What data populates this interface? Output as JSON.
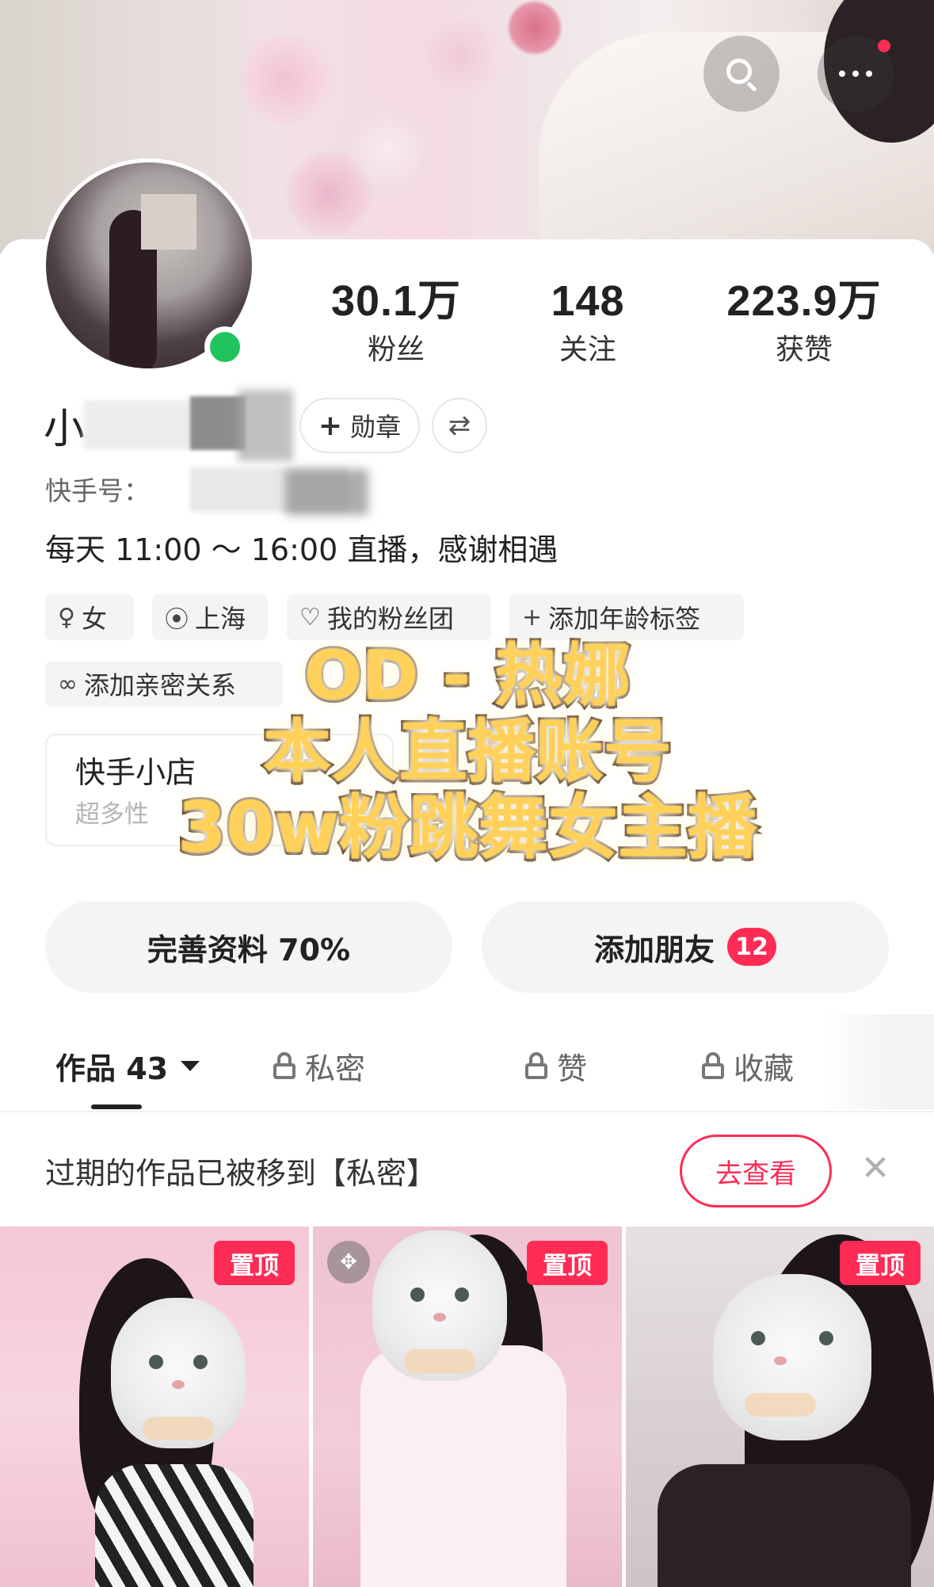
{
  "header": {
    "search_icon": "search-icon",
    "more_icon": "more-icon",
    "notification_dot_color": "#fe2c55"
  },
  "profile": {
    "nickname": "小",
    "online": true,
    "medal_label": "勋章",
    "kuaishou_id_label": "快手号：",
    "bio": "每天 11:00 ～ 16:00 直播，感谢相遇",
    "stats": [
      {
        "value": "30.1万",
        "label": "粉丝"
      },
      {
        "value": "148",
        "label": "关注"
      },
      {
        "value": "223.9万",
        "label": "获赞"
      }
    ],
    "tags": {
      "gender": "女",
      "city": "上海",
      "fan_club": "我的粉丝团",
      "add_age": "添加年龄标签",
      "add_intimate": "添加亲密关系"
    }
  },
  "shop": {
    "title": "快手小店",
    "subtitle": "超多性"
  },
  "overlay": {
    "line1": "OD - 热娜",
    "line2": "本人直播账号",
    "line3": "30w粉跳舞女主播"
  },
  "actions": {
    "complete_profile": "完善资料 70%",
    "add_friends": "添加朋友",
    "friends_badge": "12"
  },
  "tabs": {
    "works": "作品 43",
    "private": "私密",
    "likes": "赞",
    "favorites": "收藏"
  },
  "notice": {
    "text": "过期的作品已被移到【私密】",
    "button": "去查看"
  },
  "grid": {
    "pin_label": "置顶"
  },
  "colors": {
    "accent": "#fe2c55",
    "online": "#21c35e",
    "overlay_text": "#ffd15a"
  }
}
